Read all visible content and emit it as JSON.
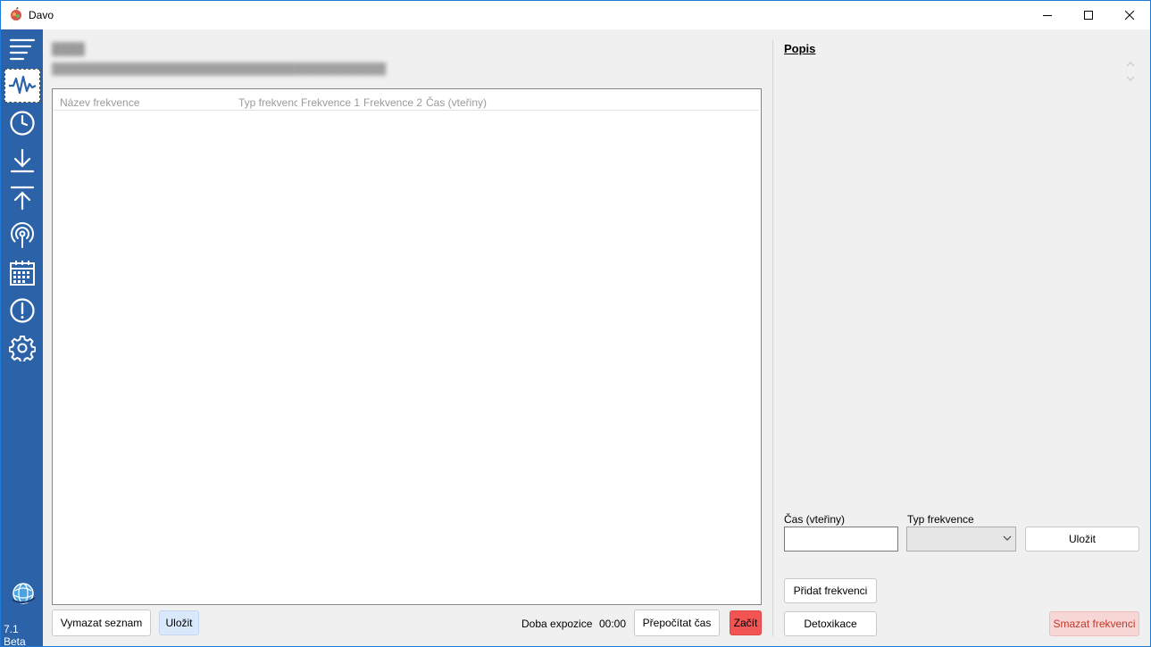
{
  "window": {
    "title": "Davo"
  },
  "sidebar": {
    "items": [
      {
        "icon": "menu-icon"
      },
      {
        "icon": "waveform-icon",
        "active": true
      },
      {
        "icon": "clock-icon"
      },
      {
        "icon": "download-icon"
      },
      {
        "icon": "upload-icon"
      },
      {
        "icon": "antenna-icon"
      },
      {
        "icon": "calendar-icon"
      },
      {
        "icon": "alert-icon"
      },
      {
        "icon": "gear-icon"
      }
    ],
    "bottom_icon": "globe-icon",
    "version": "7.1 Beta"
  },
  "main": {
    "columns": [
      "Název frekvence",
      "Typ frekvence",
      "Frekvence 1",
      "Frekvence 2",
      "Čas (vteřiny)"
    ],
    "buttons": {
      "clear": "Vymazat seznam",
      "save": "Uložit",
      "recalc": "Přepočítat čas",
      "start": "Začít"
    },
    "exposure_label": "Doba expozice",
    "exposure_value": "00:00"
  },
  "right": {
    "title": "Popis",
    "time_label": "Čas (vteřiny)",
    "time_value": "",
    "type_label": "Typ frekvence",
    "type_value": "",
    "buttons": {
      "save": "Uložit",
      "add": "Přidat frekvenci",
      "detox": "Detoxikace",
      "delete": "Smazat frekvenci"
    }
  },
  "colors": {
    "sidebar": "#2b62a8",
    "start_button": "#f25454",
    "save_button": "#dae8fb",
    "delete_button": "#f7d6d6"
  }
}
